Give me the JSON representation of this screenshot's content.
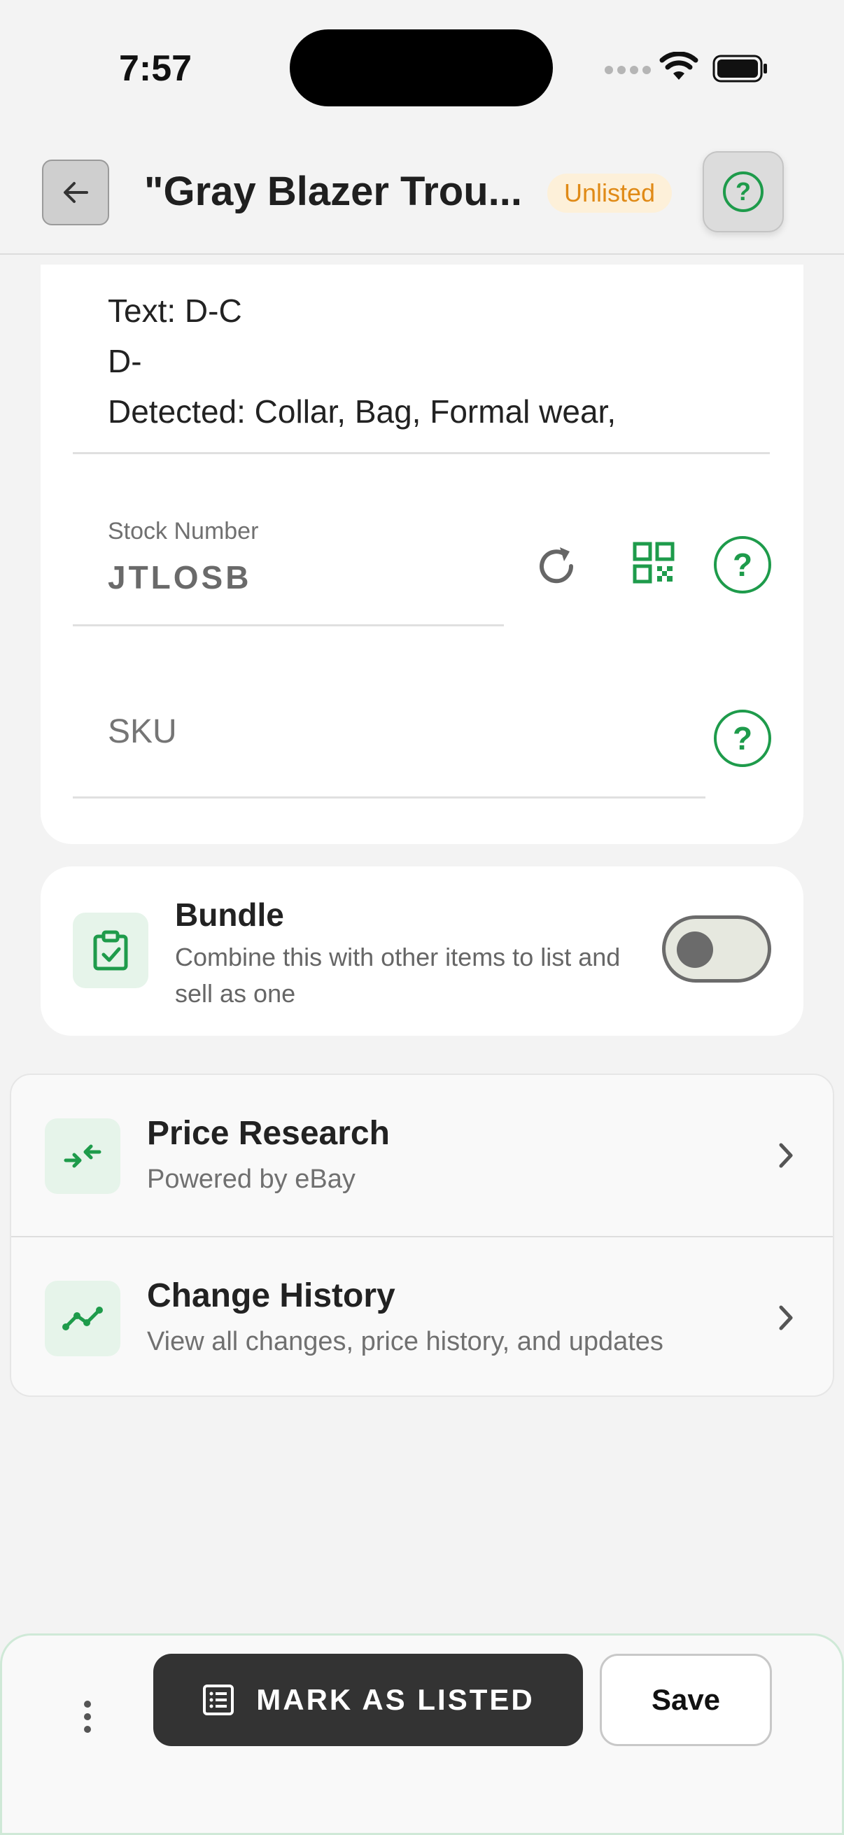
{
  "status_bar": {
    "time": "7:57"
  },
  "header": {
    "title": "\"Gray Blazer Trou...",
    "badge": "Unlisted",
    "back_icon": "arrow-left-icon",
    "help_icon": "help-circle-icon"
  },
  "details": {
    "detected_lines": [
      "Text: D-C",
      "D-",
      "Detected: Collar, Bag, Formal wear,"
    ],
    "stock_number": {
      "label": "Stock Number",
      "value": "JTLOSB"
    },
    "sku": {
      "placeholder": "SKU",
      "value": ""
    },
    "help_glyph": "?"
  },
  "bundle": {
    "title": "Bundle",
    "description": "Combine this with other items to list and sell as one",
    "enabled": false
  },
  "links": [
    {
      "title": "Price Research",
      "subtitle": "Powered by eBay",
      "icon": "compress-arrows-icon"
    },
    {
      "title": "Change History",
      "subtitle": "View all changes, price history, and updates",
      "icon": "trend-line-icon"
    }
  ],
  "bottom_bar": {
    "mark_listed_label": "MARK AS LISTED",
    "save_label": "Save"
  },
  "colors": {
    "accent_green": "#1e9b4b",
    "badge_text": "#e08a16",
    "badge_bg": "#fdf0d9",
    "primary_button": "#333333"
  }
}
